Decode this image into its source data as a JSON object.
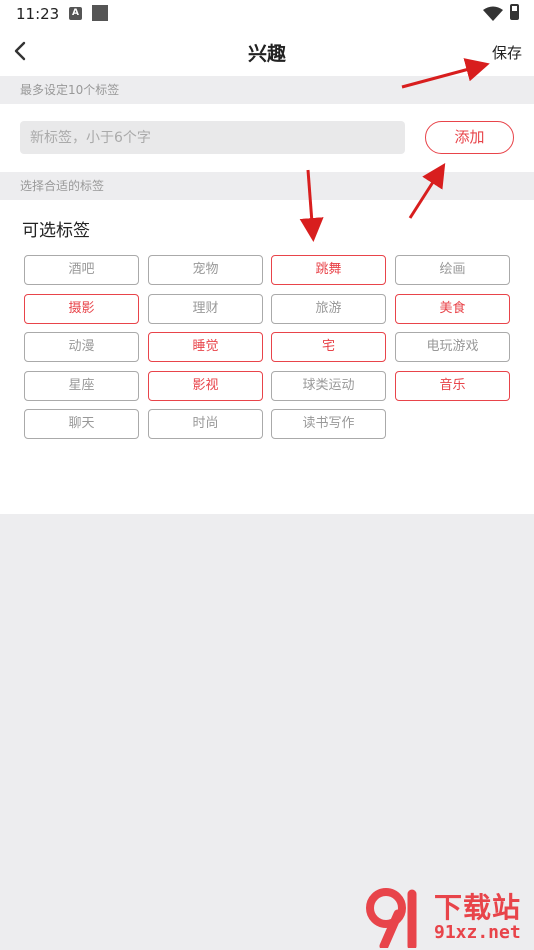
{
  "status_bar": {
    "time": "11:23",
    "icon_a": "A"
  },
  "header": {
    "title": "兴趣",
    "save_label": "保存"
  },
  "section1": {
    "label": "最多设定10个标签"
  },
  "input": {
    "placeholder": "新标签，小于6个字",
    "add_label": "添加"
  },
  "section2": {
    "label": "选择合适的标签"
  },
  "tags": {
    "title": "可选标签",
    "items": [
      {
        "label": "酒吧",
        "selected": false
      },
      {
        "label": "宠物",
        "selected": false
      },
      {
        "label": "跳舞",
        "selected": true
      },
      {
        "label": "绘画",
        "selected": false
      },
      {
        "label": "摄影",
        "selected": true
      },
      {
        "label": "理财",
        "selected": false
      },
      {
        "label": "旅游",
        "selected": false
      },
      {
        "label": "美食",
        "selected": true
      },
      {
        "label": "动漫",
        "selected": false
      },
      {
        "label": "睡觉",
        "selected": true
      },
      {
        "label": "宅",
        "selected": true
      },
      {
        "label": "电玩游戏",
        "selected": false
      },
      {
        "label": "星座",
        "selected": false
      },
      {
        "label": "影视",
        "selected": true
      },
      {
        "label": "球类运动",
        "selected": false
      },
      {
        "label": "音乐",
        "selected": true
      },
      {
        "label": "聊天",
        "selected": false
      },
      {
        "label": "时尚",
        "selected": false
      },
      {
        "label": "读书写作",
        "selected": false
      }
    ]
  },
  "watermark": {
    "text_main": "下载站",
    "text_url": "91xz.net"
  },
  "colors": {
    "accent": "#e8444a",
    "tag_border": "#aaaaaa",
    "background": "#ededef"
  }
}
